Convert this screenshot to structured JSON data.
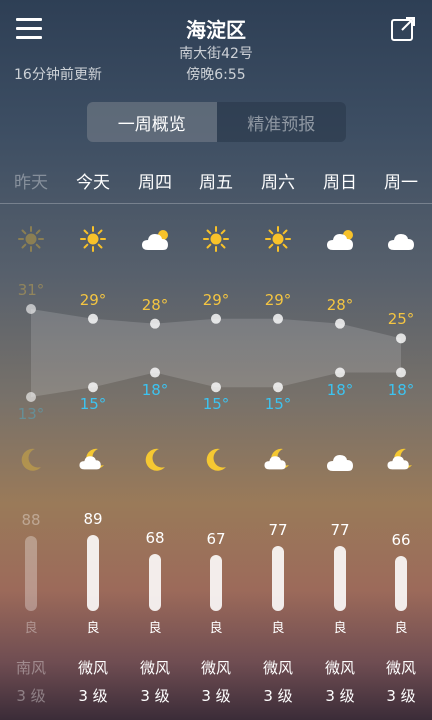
{
  "header": {
    "city": "海淀区",
    "street": "南大街42号",
    "time": "傍晚6:55",
    "updated": "16分钟前更新"
  },
  "tabs": [
    {
      "label": "一周概览",
      "active": true
    },
    {
      "label": "精准预报",
      "active": false
    }
  ],
  "days": [
    {
      "label": "昨天",
      "day_icon": "sun-icon",
      "night_icon": "moon-icon",
      "high": 31,
      "high_label": "31°",
      "low": 13,
      "low_label": "13°",
      "aqi": 88,
      "aqi_label": "88",
      "aqi_level": "良",
      "wind_dir": "南风",
      "wind_level": "3 级",
      "past": true
    },
    {
      "label": "今天",
      "day_icon": "sun-icon",
      "night_icon": "moon-cloud-icon",
      "high": 29,
      "high_label": "29°",
      "low": 15,
      "low_label": "15°",
      "aqi": 89,
      "aqi_label": "89",
      "aqi_level": "良",
      "wind_dir": "微风",
      "wind_level": "3 级",
      "past": false
    },
    {
      "label": "周四",
      "day_icon": "cloud-sun-icon",
      "night_icon": "moon-icon",
      "high": 28,
      "high_label": "28°",
      "low": 18,
      "low_label": "18°",
      "aqi": 68,
      "aqi_label": "68",
      "aqi_level": "良",
      "wind_dir": "微风",
      "wind_level": "3 级",
      "past": false
    },
    {
      "label": "周五",
      "day_icon": "sun-icon",
      "night_icon": "moon-icon",
      "high": 29,
      "high_label": "29°",
      "low": 15,
      "low_label": "15°",
      "aqi": 67,
      "aqi_label": "67",
      "aqi_level": "良",
      "wind_dir": "微风",
      "wind_level": "3 级",
      "past": false
    },
    {
      "label": "周六",
      "day_icon": "sun-icon",
      "night_icon": "moon-cloud-icon",
      "high": 29,
      "high_label": "29°",
      "low": 15,
      "low_label": "15°",
      "aqi": 77,
      "aqi_label": "77",
      "aqi_level": "良",
      "wind_dir": "微风",
      "wind_level": "3 级",
      "past": false
    },
    {
      "label": "周日",
      "day_icon": "cloud-sun-icon",
      "night_icon": "cloud-icon",
      "high": 28,
      "high_label": "28°",
      "low": 18,
      "low_label": "18°",
      "aqi": 77,
      "aqi_label": "77",
      "aqi_level": "良",
      "wind_dir": "微风",
      "wind_level": "3 级",
      "past": false
    },
    {
      "label": "周一",
      "day_icon": "cloud-icon",
      "night_icon": "moon-cloud-icon",
      "high": 25,
      "high_label": "25°",
      "low": 18,
      "low_label": "18°",
      "aqi": 66,
      "aqi_label": "66",
      "aqi_level": "良",
      "wind_dir": "微风",
      "wind_level": "3 级",
      "past": false
    }
  ],
  "colors": {
    "high_temp": "#f4c542",
    "low_temp": "#3dc3f0",
    "sun": "#f8c22a",
    "moon": "#f5c832"
  }
}
